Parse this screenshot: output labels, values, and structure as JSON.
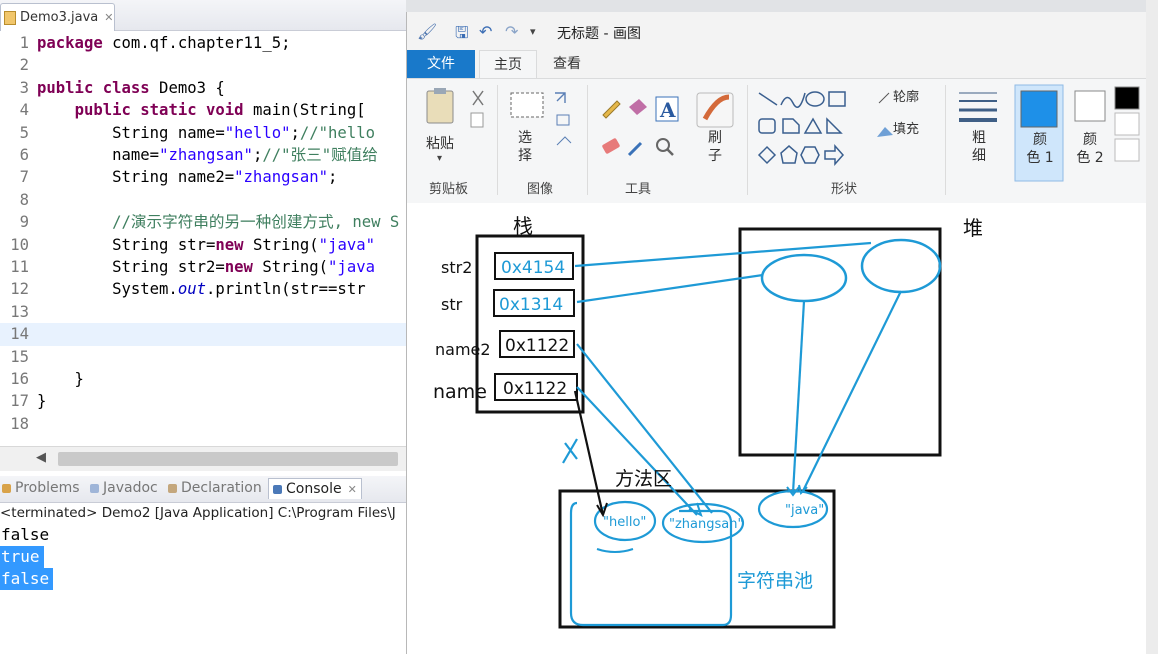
{
  "editor": {
    "tab_title": "Demo3.java",
    "tab_close": "✕",
    "lines": [
      {
        "num": "1",
        "tokens": [
          [
            "kw",
            "package"
          ],
          [
            "pl",
            " com.qf.chapter11_5;"
          ]
        ]
      },
      {
        "num": "2",
        "tokens": []
      },
      {
        "num": "3",
        "tokens": [
          [
            "kw",
            "public class"
          ],
          [
            "pl",
            " Demo3 {"
          ]
        ]
      },
      {
        "num": "4",
        "tokens": [
          [
            "pl",
            "    "
          ],
          [
            "kw",
            "public static void"
          ],
          [
            "pl",
            " main(String["
          ]
        ]
      },
      {
        "num": "5",
        "tokens": [
          [
            "pl",
            "        String name="
          ],
          [
            "str",
            "\"hello\""
          ],
          [
            "pl",
            ";"
          ],
          [
            "cm",
            "//\"hello"
          ]
        ]
      },
      {
        "num": "6",
        "tokens": [
          [
            "pl",
            "        name="
          ],
          [
            "str",
            "\"zhangsan\""
          ],
          [
            "pl",
            ";"
          ],
          [
            "cm",
            "//\"张三\"赋值给"
          ]
        ]
      },
      {
        "num": "7",
        "tokens": [
          [
            "pl",
            "        String name2="
          ],
          [
            "str",
            "\"zhangsan\""
          ],
          [
            "pl",
            ";"
          ]
        ]
      },
      {
        "num": "8",
        "tokens": []
      },
      {
        "num": "9",
        "tokens": [
          [
            "pl",
            "        "
          ],
          [
            "cm",
            "//演示字符串的另一种创建方式, new S"
          ]
        ]
      },
      {
        "num": "10",
        "tokens": [
          [
            "pl",
            "        String str="
          ],
          [
            "kw",
            "new"
          ],
          [
            "pl",
            " String("
          ],
          [
            "str",
            "\"java\""
          ]
        ]
      },
      {
        "num": "11",
        "tokens": [
          [
            "pl",
            "        String str2="
          ],
          [
            "kw",
            "new"
          ],
          [
            "pl",
            " String("
          ],
          [
            "str",
            "\"java"
          ]
        ]
      },
      {
        "num": "12",
        "tokens": [
          [
            "pl",
            "        System."
          ],
          [
            "fld",
            "out"
          ],
          [
            "pl",
            ".println(str==str"
          ]
        ]
      },
      {
        "num": "13",
        "tokens": []
      },
      {
        "num": "14",
        "tokens": []
      },
      {
        "num": "15",
        "tokens": []
      },
      {
        "num": "16",
        "tokens": [
          [
            "pl",
            "    }"
          ]
        ]
      },
      {
        "num": "17",
        "tokens": [
          [
            "pl",
            "}"
          ]
        ]
      },
      {
        "num": "18",
        "tokens": []
      }
    ]
  },
  "bottom_tabs": {
    "problems": "Problems",
    "javadoc": "Javadoc",
    "declaration": "Declaration",
    "console": "Console"
  },
  "console": {
    "header": "<terminated> Demo2 [Java Application] C:\\Program Files\\J",
    "output": [
      "false",
      "true",
      "false"
    ]
  },
  "paint": {
    "title": "无标题 - 画图",
    "tabs": {
      "file": "文件",
      "home": "主页",
      "view": "查看"
    },
    "ribbon": {
      "paste": "粘贴",
      "select": "选\n择",
      "brush": "刷\n子",
      "outline": "轮廓",
      "fill": "填充",
      "size": "粗\n细",
      "color1": "颜\n色 1",
      "color2": "颜\n色 2",
      "groups": {
        "clipboard": "剪贴板",
        "image": "图像",
        "tools": "工具",
        "shapes": "形状"
      }
    },
    "colors": {
      "color1": "#1e90e8",
      "color2": "#ffffff",
      "palette_black": "#000000",
      "ink": "#1e9ad6"
    },
    "diagram": {
      "stack_label": "栈",
      "heap_label": "堆",
      "method_area_label": "方法区",
      "string_pool_label": "字符串池",
      "stack_vars": [
        "str2",
        "str",
        "name2",
        "name"
      ],
      "stack_vals": [
        "0x4154",
        "0x1314",
        "0x1122",
        "0x1122"
      ],
      "pool_strings": [
        "\"hello\"",
        "\"zhangsan\"",
        "\"java\""
      ]
    }
  }
}
